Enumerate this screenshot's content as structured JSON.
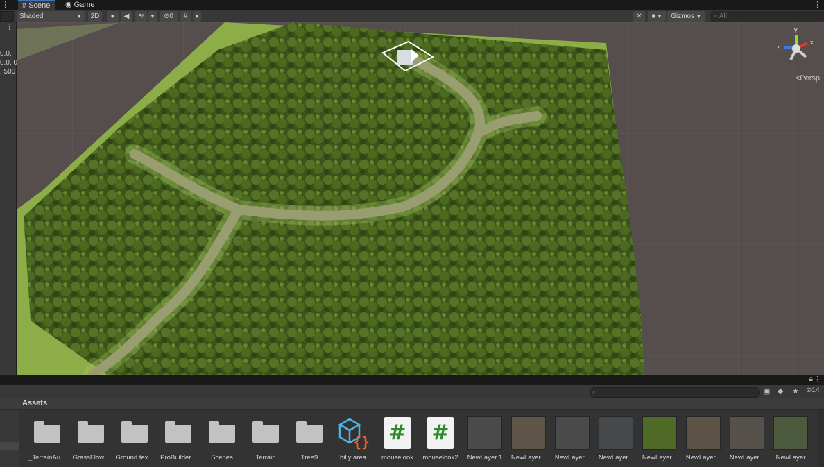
{
  "tabs": {
    "scene": "Scene",
    "game": "Game"
  },
  "toolbar": {
    "shading_mode": "Shaded",
    "mode_2d": "2D",
    "hidden_count": "0",
    "gizmos": "Gizmos",
    "search_placeholder": "All"
  },
  "inspector": {
    "lines": [
      "0.0,",
      "0.0, 0",
      ", 500"
    ]
  },
  "viewport": {
    "projection_label": "Persp"
  },
  "orientation_gizmo": {
    "y": "y",
    "x": "x",
    "z": "z"
  },
  "assets_toolbar": {
    "visibility_count": "14"
  },
  "assets": {
    "title": "Assets",
    "items": [
      {
        "label": "_TerrainAu...",
        "type": "folder"
      },
      {
        "label": "GrassFlow...",
        "type": "folder"
      },
      {
        "label": "Ground tex...",
        "type": "folder"
      },
      {
        "label": "ProBuilder...",
        "type": "folder"
      },
      {
        "label": "Scenes",
        "type": "folder"
      },
      {
        "label": "Terrain",
        "type": "folder"
      },
      {
        "label": "Tree9",
        "type": "folder"
      },
      {
        "label": "hilly area",
        "type": "prefab"
      },
      {
        "label": "mouselook",
        "type": "script"
      },
      {
        "label": "mouselook2",
        "type": "script"
      },
      {
        "label": "NewLayer 1",
        "type": "layer"
      },
      {
        "label": "NewLayer...",
        "type": "layer"
      },
      {
        "label": "NewLayer...",
        "type": "layer"
      },
      {
        "label": "NewLayer...",
        "type": "layer"
      },
      {
        "label": "NewLayer...",
        "type": "layer"
      },
      {
        "label": "NewLayer...",
        "type": "layer"
      },
      {
        "label": "NewLayer...",
        "type": "layer"
      },
      {
        "label": "NewLayer",
        "type": "layer"
      }
    ]
  },
  "colors": {
    "accent": "#3a79bb",
    "terrain_ground": "#564e4c",
    "forest": "#3f5a1c",
    "grass": "#8db04a",
    "path": "#8a8270"
  }
}
